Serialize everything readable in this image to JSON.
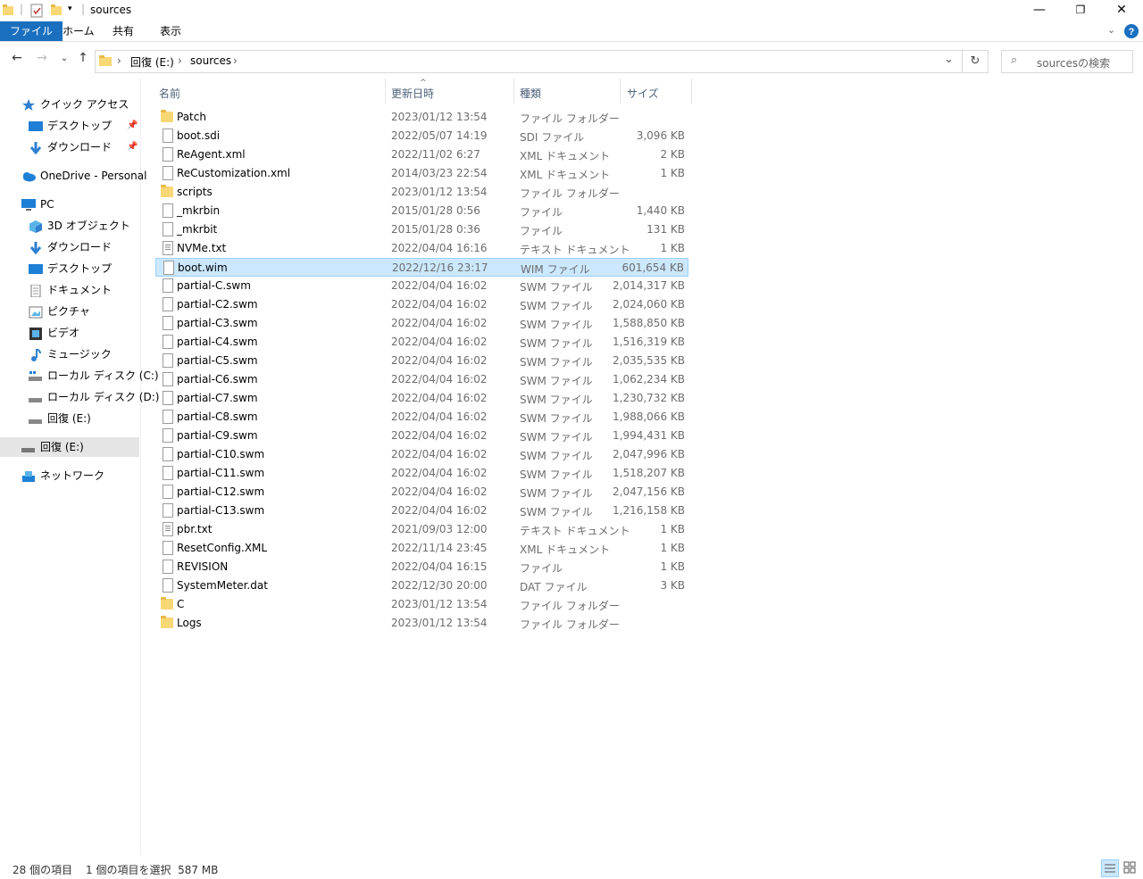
{
  "window": {
    "title": "sources",
    "min_glyph": "—",
    "max_glyph": "❐",
    "close_glyph": "✕"
  },
  "ribbon": {
    "tabs": [
      "ファイル",
      "ホーム",
      "共有",
      "表示"
    ]
  },
  "address": {
    "crumbs": [
      "回復 (E:)",
      "sources"
    ],
    "search_placeholder": "sourcesの検索"
  },
  "nav": {
    "items": [
      {
        "label": "クイック アクセス",
        "icon": "star-icon"
      },
      {
        "label": "デスクトップ",
        "icon": "desktop-icon",
        "pinned": true
      },
      {
        "label": "ダウンロード",
        "icon": "download-icon",
        "pinned": true
      },
      {
        "label": "OneDrive - Personal",
        "icon": "cloud-icon"
      },
      {
        "label": "PC",
        "icon": "pc-icon"
      },
      {
        "label": "3D オブジェクト",
        "icon": "cube-icon"
      },
      {
        "label": "ダウンロード",
        "icon": "download-icon"
      },
      {
        "label": "デスクトップ",
        "icon": "desktop-icon"
      },
      {
        "label": "ドキュメント",
        "icon": "document-icon"
      },
      {
        "label": "ピクチャ",
        "icon": "picture-icon"
      },
      {
        "label": "ビデオ",
        "icon": "video-icon"
      },
      {
        "label": "ミュージック",
        "icon": "music-icon"
      },
      {
        "label": "ローカル ディスク (C:)",
        "icon": "drive-c-icon"
      },
      {
        "label": "ローカル ディスク (D:)",
        "icon": "drive-icon"
      },
      {
        "label": "回復 (E:)",
        "icon": "drive-icon"
      },
      {
        "label": "回復 (E:)",
        "icon": "drive-icon",
        "selected": true
      },
      {
        "label": "ネットワーク",
        "icon": "network-icon"
      }
    ]
  },
  "columns": {
    "name": "名前",
    "date": "更新日時",
    "type": "種類",
    "size": "サイズ"
  },
  "files": [
    {
      "name": "Patch",
      "date": "2023/01/12 13:54",
      "type": "ファイル フォルダー",
      "size": "",
      "kind": "folder"
    },
    {
      "name": "boot.sdi",
      "date": "2022/05/07 14:19",
      "type": "SDI ファイル",
      "size": "3,096 KB",
      "kind": "file"
    },
    {
      "name": "ReAgent.xml",
      "date": "2022/11/02 6:27",
      "type": "XML ドキュメント",
      "size": "2 KB",
      "kind": "file"
    },
    {
      "name": "ReCustomization.xml",
      "date": "2014/03/23 22:54",
      "type": "XML ドキュメント",
      "size": "1 KB",
      "kind": "file"
    },
    {
      "name": "scripts",
      "date": "2023/01/12 13:54",
      "type": "ファイル フォルダー",
      "size": "",
      "kind": "folder"
    },
    {
      "name": "_mkrbin",
      "date": "2015/01/28 0:56",
      "type": "ファイル",
      "size": "1,440 KB",
      "kind": "file"
    },
    {
      "name": "_mkrbit",
      "date": "2015/01/28 0:36",
      "type": "ファイル",
      "size": "131 KB",
      "kind": "file"
    },
    {
      "name": "NVMe.txt",
      "date": "2022/04/04 16:16",
      "type": "テキスト ドキュメント",
      "size": "1 KB",
      "kind": "text"
    },
    {
      "name": "boot.wim",
      "date": "2022/12/16 23:17",
      "type": "WIM ファイル",
      "size": "601,654 KB",
      "kind": "file",
      "selected": true
    },
    {
      "name": "partial-C.swm",
      "date": "2022/04/04 16:02",
      "type": "SWM ファイル",
      "size": "2,014,317 KB",
      "kind": "file"
    },
    {
      "name": "partial-C2.swm",
      "date": "2022/04/04 16:02",
      "type": "SWM ファイル",
      "size": "2,024,060 KB",
      "kind": "file"
    },
    {
      "name": "partial-C3.swm",
      "date": "2022/04/04 16:02",
      "type": "SWM ファイル",
      "size": "1,588,850 KB",
      "kind": "file"
    },
    {
      "name": "partial-C4.swm",
      "date": "2022/04/04 16:02",
      "type": "SWM ファイル",
      "size": "1,516,319 KB",
      "kind": "file"
    },
    {
      "name": "partial-C5.swm",
      "date": "2022/04/04 16:02",
      "type": "SWM ファイル",
      "size": "2,035,535 KB",
      "kind": "file"
    },
    {
      "name": "partial-C6.swm",
      "date": "2022/04/04 16:02",
      "type": "SWM ファイル",
      "size": "1,062,234 KB",
      "kind": "file"
    },
    {
      "name": "partial-C7.swm",
      "date": "2022/04/04 16:02",
      "type": "SWM ファイル",
      "size": "1,230,732 KB",
      "kind": "file"
    },
    {
      "name": "partial-C8.swm",
      "date": "2022/04/04 16:02",
      "type": "SWM ファイル",
      "size": "1,988,066 KB",
      "kind": "file"
    },
    {
      "name": "partial-C9.swm",
      "date": "2022/04/04 16:02",
      "type": "SWM ファイル",
      "size": "1,994,431 KB",
      "kind": "file"
    },
    {
      "name": "partial-C10.swm",
      "date": "2022/04/04 16:02",
      "type": "SWM ファイル",
      "size": "2,047,996 KB",
      "kind": "file"
    },
    {
      "name": "partial-C11.swm",
      "date": "2022/04/04 16:02",
      "type": "SWM ファイル",
      "size": "1,518,207 KB",
      "kind": "file"
    },
    {
      "name": "partial-C12.swm",
      "date": "2022/04/04 16:02",
      "type": "SWM ファイル",
      "size": "2,047,156 KB",
      "kind": "file"
    },
    {
      "name": "partial-C13.swm",
      "date": "2022/04/04 16:02",
      "type": "SWM ファイル",
      "size": "1,216,158 KB",
      "kind": "file"
    },
    {
      "name": "pbr.txt",
      "date": "2021/09/03 12:00",
      "type": "テキスト ドキュメント",
      "size": "1 KB",
      "kind": "text"
    },
    {
      "name": "ResetConfig.XML",
      "date": "2022/11/14 23:45",
      "type": "XML ドキュメント",
      "size": "1 KB",
      "kind": "file"
    },
    {
      "name": "REVISION",
      "date": "2022/04/04 16:15",
      "type": "ファイル",
      "size": "1 KB",
      "kind": "file"
    },
    {
      "name": "SystemMeter.dat",
      "date": "2022/12/30 20:00",
      "type": "DAT ファイル",
      "size": "3 KB",
      "kind": "file"
    },
    {
      "name": "C",
      "date": "2023/01/12 13:54",
      "type": "ファイル フォルダー",
      "size": "",
      "kind": "folder"
    },
    {
      "name": "Logs",
      "date": "2023/01/12 13:54",
      "type": "ファイル フォルダー",
      "size": "",
      "kind": "folder"
    }
  ],
  "status": {
    "count": "28 個の項目",
    "selection": "1 個の項目を選択  587 MB"
  },
  "colors": {
    "accent": "#1a6fbf",
    "selection_bg": "#cce8ff",
    "selection_border": "#99d1ff"
  }
}
